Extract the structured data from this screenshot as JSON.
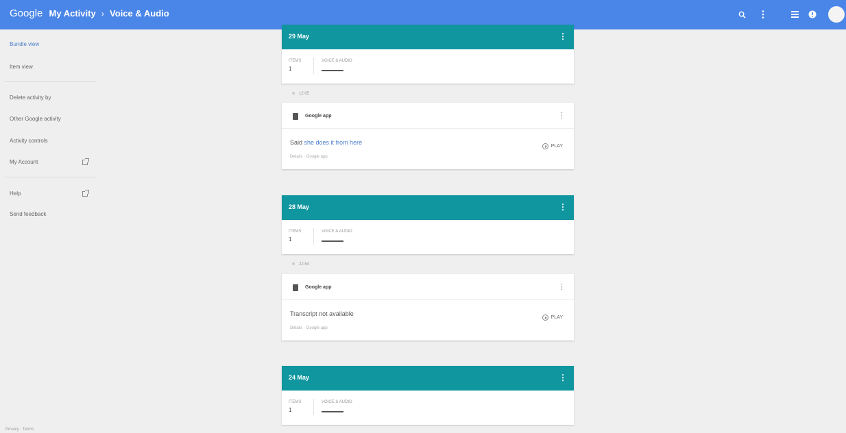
{
  "header": {
    "brand": "Google",
    "breadcrumb_root": "My Activity",
    "separator": "›",
    "breadcrumb_current": "Voice & Audio",
    "bg_color": "#4a86e8",
    "icons": [
      "search-icon",
      "more-vert-icon",
      "apps-icon",
      "notifications-icon",
      "avatar"
    ]
  },
  "sidebar": {
    "items": [
      {
        "label": "Bundle view",
        "active": true
      },
      {
        "label": "Item view"
      },
      {
        "label": "Delete activity by"
      },
      {
        "label": "Other Google activity"
      },
      {
        "label": "Activity controls"
      },
      {
        "label": "My Account",
        "external": true
      },
      {
        "label": "Help",
        "external": true
      },
      {
        "label": "Send feedback"
      }
    ],
    "footer": "Privacy · Terms"
  },
  "days": [
    {
      "date": "29 May",
      "items_label": "ITEMS",
      "items_count": "1",
      "product_label": "VOICE & AUDIO",
      "time": "12:05",
      "entry": {
        "app": "Google app",
        "text_prefix": "Said",
        "query": "she does it from here",
        "details": "Details · Google app",
        "play_label": "PLAY"
      }
    },
    {
      "date": "28 May",
      "items_label": "ITEMS",
      "items_count": "1",
      "product_label": "VOICE & AUDIO",
      "time": "22:54",
      "entry": {
        "app": "Google app",
        "text_prefix": "Transcript not available",
        "query": "",
        "details": "Details · Google app",
        "play_label": "PLAY"
      }
    },
    {
      "date": "24 May",
      "items_label": "ITEMS",
      "items_count": "1",
      "product_label": "VOICE & AUDIO"
    }
  ],
  "colors": {
    "header": "#4a86e8",
    "day_header": "#0f969f",
    "background": "#efefef",
    "link": "#4a7ec9"
  }
}
